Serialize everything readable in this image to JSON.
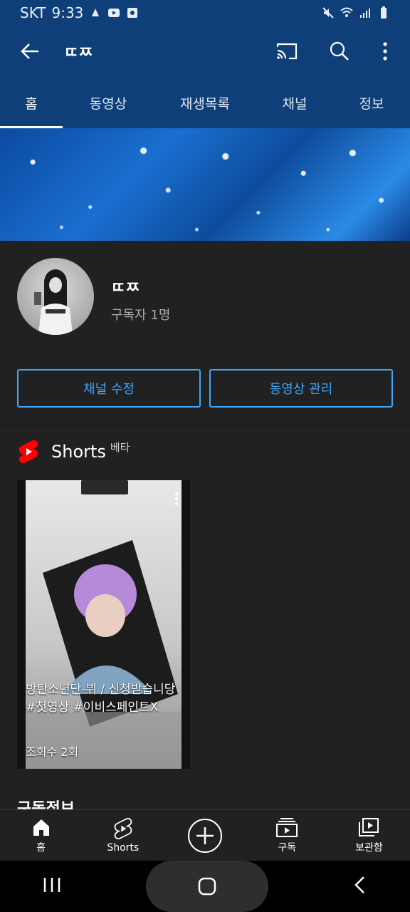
{
  "status_bar": {
    "carrier": "SKT",
    "time": "9:33"
  },
  "app_bar": {
    "title": "ㄸㅉ"
  },
  "tabs": [
    {
      "label": "홈",
      "active": true
    },
    {
      "label": "동영상"
    },
    {
      "label": "재생목록"
    },
    {
      "label": "채널"
    },
    {
      "label": "정보"
    }
  ],
  "channel": {
    "name": "ㄸㅉ",
    "subscribers": "구독자 1명",
    "edit_button": "채널 수정",
    "manage_button": "동영상 관리"
  },
  "shorts": {
    "title": "Shorts",
    "badge": "베타",
    "items": [
      {
        "title": "방탄소년단-뷔 / 신청받습니당 #첫영상 #이비스페인트X",
        "views": "조회수 2회"
      }
    ]
  },
  "next_section_title": "구독정보",
  "bottom_nav": [
    {
      "label": "홈",
      "icon": "home-icon"
    },
    {
      "label": "Shorts",
      "icon": "shorts-icon"
    },
    {
      "label": "",
      "icon": "create-icon"
    },
    {
      "label": "구독",
      "icon": "subscriptions-icon"
    },
    {
      "label": "보관함",
      "icon": "library-icon"
    }
  ],
  "colors": {
    "header_bg": "#0e3f78",
    "accent": "#3ea6ff",
    "bg": "#212121"
  }
}
